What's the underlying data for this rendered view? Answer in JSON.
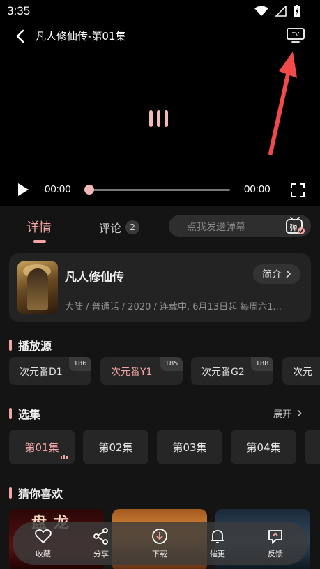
{
  "status_bar": {
    "time": "3:35"
  },
  "player": {
    "title": "凡人修仙传-第01集",
    "current_time": "00:00",
    "total_time": "00:00",
    "progress": 0
  },
  "tabs": {
    "detail": "详情",
    "comment": "评论",
    "comment_count": "2",
    "danmaku_placeholder": "点我发送弹幕"
  },
  "show": {
    "title": "凡人修仙传",
    "intro_label": "简介",
    "meta": "大陆 / 普通话 / 2020 / 连载中, 6月13日起 每周六1..."
  },
  "sources": {
    "heading": "播放源",
    "items": [
      {
        "label": "次元番D1",
        "count": "186"
      },
      {
        "label": "次元番Y1",
        "count": "185"
      },
      {
        "label": "次元番G2",
        "count": "188"
      },
      {
        "label": "次元",
        "count": ""
      }
    ]
  },
  "episodes": {
    "heading": "选集",
    "expand_label": "展开",
    "items": [
      "第01集",
      "第02集",
      "第03集",
      "第04集"
    ]
  },
  "recommend": {
    "heading": "猜你喜欢",
    "first_title": "盘龙"
  },
  "actions": {
    "favorite": "收藏",
    "share": "分享",
    "download": "下载",
    "urge": "催更",
    "feedback": "反馈"
  },
  "colors": {
    "accent": "#f2a6a6",
    "background": "#141414",
    "card": "#232323"
  }
}
